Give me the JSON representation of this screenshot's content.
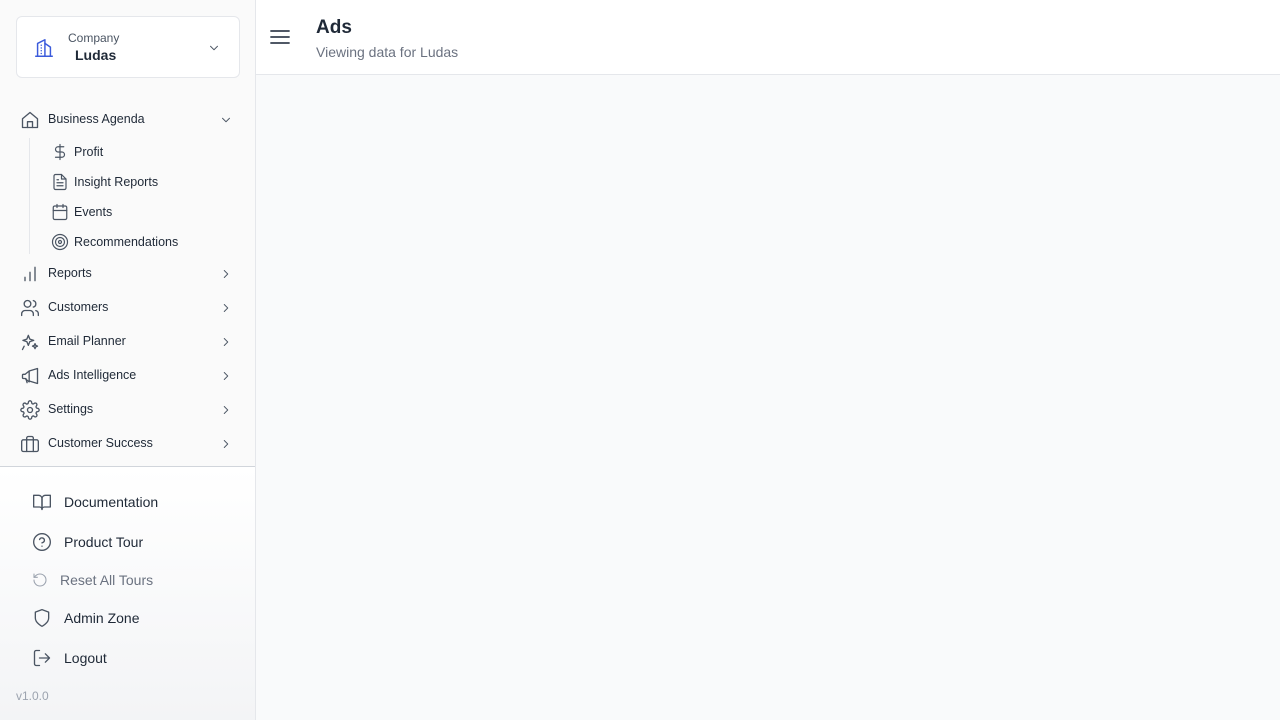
{
  "company": {
    "label": "Company",
    "name": "Ludas"
  },
  "nav": {
    "business_agenda": "Business Agenda",
    "sub_items": {
      "profit": "Profit",
      "insight_reports": "Insight Reports",
      "events": "Events",
      "recommendations": "Recommendations"
    },
    "reports": "Reports",
    "customers": "Customers",
    "email_planner": "Email Planner",
    "ads_intelligence": "Ads Intelligence",
    "settings": "Settings",
    "customer_success": "Customer Success"
  },
  "utility": {
    "documentation": "Documentation",
    "product_tour": "Product Tour",
    "reset_all_tours": "Reset All Tours",
    "admin_zone": "Admin Zone",
    "logout": "Logout"
  },
  "version": "v1.0.0",
  "header": {
    "title": "Ads",
    "subtitle": "Viewing data for Ludas"
  },
  "icons": {
    "company": "building-icon",
    "business_agenda": "home-icon",
    "profit": "dollar-icon",
    "insight_reports": "document-icon",
    "events": "calendar-icon",
    "recommendations": "target-icon",
    "reports": "bar-chart-icon",
    "customers": "users-icon",
    "email_planner": "sparkles-icon",
    "ads_intelligence": "megaphone-icon",
    "settings": "gear-icon",
    "customer_success": "briefcase-icon",
    "documentation": "book-icon",
    "product_tour": "help-circle-icon",
    "reset_all_tours": "rotate-ccw-icon",
    "admin_zone": "shield-icon",
    "logout": "logout-icon",
    "menu": "hamburger-menu-icon"
  },
  "colors": {
    "accent": "#3b5bdb",
    "text": "#1f2937",
    "muted": "#6b7280",
    "sidebar_bg": "#fafafa",
    "content_bg": "#f9fafb"
  }
}
